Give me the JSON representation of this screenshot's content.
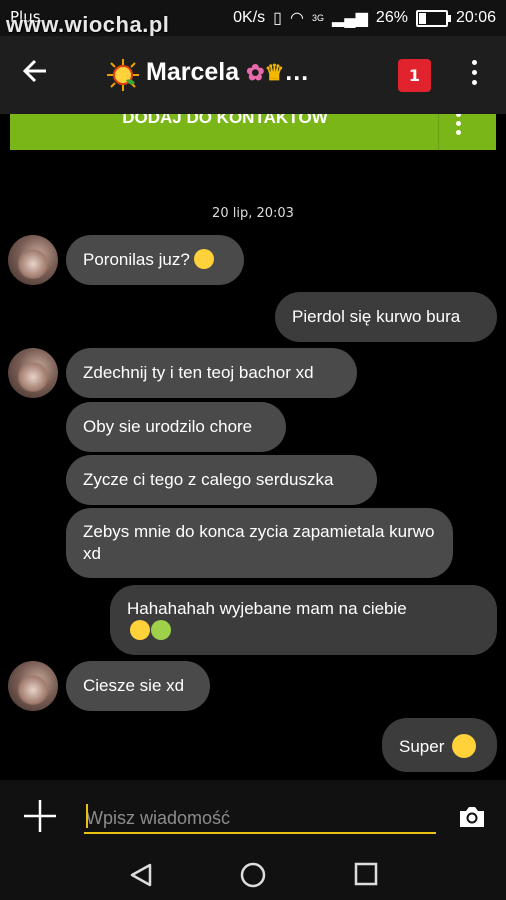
{
  "statusbar": {
    "carrier": "Plus",
    "watermark": "www.wiocha.pl",
    "net_speed": "0K/s",
    "network": "3G",
    "battery": "26%",
    "battery_fraction": 0.26,
    "time": "20:06"
  },
  "header": {
    "title": "Marcela",
    "title_suffix": "…",
    "badge": "1"
  },
  "add_contact": {
    "label": "DODAJ DO KONTAKTÓW"
  },
  "chat": {
    "date": "20 lip, 20:03",
    "messages": [
      {
        "side": "in",
        "text": "Poronilas juz?",
        "emoji": [
          "grin"
        ]
      },
      {
        "side": "out",
        "text": "Pierdol się kurwo bura"
      },
      {
        "side": "in",
        "text": "Zdechnij ty i ten teoj bachor xd"
      },
      {
        "side": "in",
        "text": "Oby sie urodzilo chore"
      },
      {
        "side": "in",
        "text": "Zycze ci tego z calego serduszka"
      },
      {
        "side": "in",
        "text": "Zebys mnie do konca zycia zapamietala kurwo xd"
      },
      {
        "side": "out",
        "text": "Hahahahah wyjebane mam na ciebie",
        "emoji": [
          "laugh",
          "tennis-ball"
        ]
      },
      {
        "side": "in",
        "text": "Ciesze sie xd"
      },
      {
        "side": "out",
        "text": "Super",
        "emoji": [
          "smile"
        ]
      }
    ]
  },
  "composer": {
    "placeholder": "Wpisz wiadomość"
  },
  "colors": {
    "accent_green": "#7ab617",
    "badge_red": "#e0232d",
    "input_underline": "#e8c20f"
  }
}
